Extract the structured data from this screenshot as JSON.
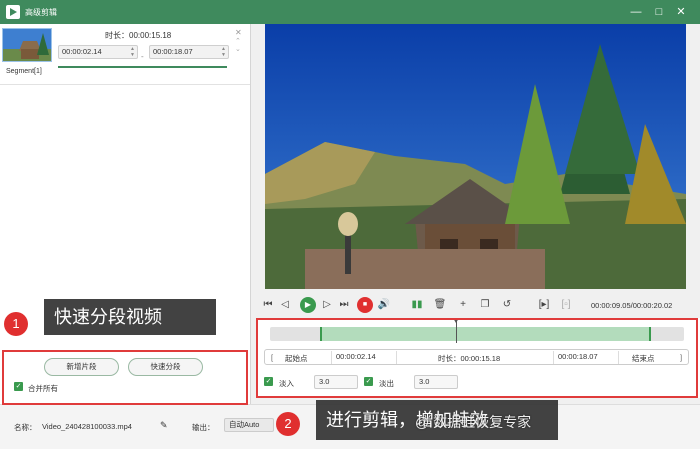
{
  "window": {
    "title": "高级剪辑"
  },
  "segment": {
    "label": "Segment[1]",
    "duration_label": "时长：00:00:15.18",
    "start": "00:00:02.14",
    "end": "00:00:18.07"
  },
  "buttons": {
    "new_segment": "新增片段",
    "quick_split": "快速分段"
  },
  "merge_all": {
    "label": "合并所有",
    "checked": true
  },
  "player": {
    "timecode": "00:00:09.05/00:00:20.02"
  },
  "range": {
    "start_label": "起始点",
    "start": "00:00:02.14",
    "duration": "时长：00:00:15.18",
    "end": "00:00:18.07",
    "end_label": "结束点"
  },
  "track": {
    "selection_start": 0.12,
    "selection_end": 0.92,
    "playhead": 0.45
  },
  "fade": {
    "in_label": "淡入",
    "in_value": "3.0",
    "out_label": "淡出",
    "out_value": "3.0"
  },
  "file": {
    "name_label": "名称：",
    "name": "Video_240428100033.mp4",
    "output_label": "输出：",
    "output_value": "自动Auto"
  },
  "annotations": [
    {
      "number": "1",
      "text": "快速分段视频"
    },
    {
      "number": "2",
      "text": "进行剪辑，增加特效"
    }
  ],
  "watermark": "@ 数据蛙恢复专家",
  "colors": {
    "accent": "#3f8a5d",
    "highlight": "#e03b3b"
  }
}
